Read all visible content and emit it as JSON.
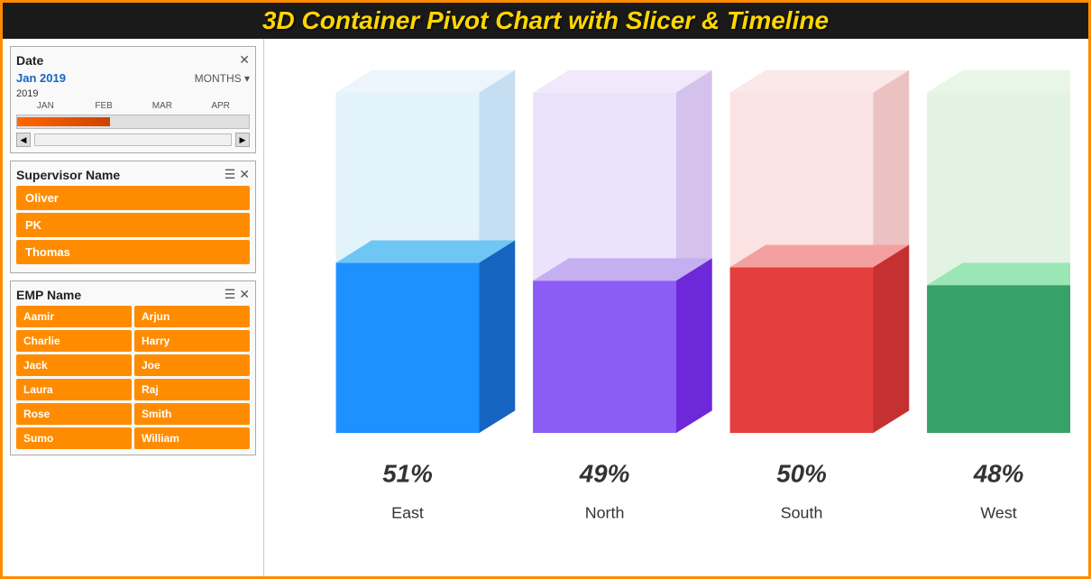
{
  "title": "3D Container Pivot Chart with Slicer & Timeline",
  "timeline": {
    "label": "Date",
    "selected": "Jan 2019",
    "period": "MONTHS",
    "year": "2019",
    "months": [
      "JAN",
      "FEB",
      "MAR",
      "APR"
    ]
  },
  "supervisor_slicer": {
    "label": "Supervisor Name",
    "items": [
      "Oliver",
      "PK",
      "Thomas"
    ]
  },
  "emp_slicer": {
    "label": "EMP Name",
    "items": [
      "Aamir",
      "Arjun",
      "Charlie",
      "Harry",
      "Jack",
      "Joe",
      "Laura",
      "Raj",
      "Rose",
      "Smith",
      "Sumo",
      "William"
    ]
  },
  "chart": {
    "bars": [
      {
        "label": "East",
        "percent": "51%",
        "color_front": "#1e90ff",
        "color_top": "#a8d8f0",
        "color_side": "#1565c0"
      },
      {
        "label": "North",
        "percent": "49%",
        "color_front": "#8b5cf6",
        "color_top": "#c4b5f0",
        "color_side": "#6d28d9"
      },
      {
        "label": "South",
        "percent": "50%",
        "color_front": "#e53e3e",
        "color_top": "#f5a0a0",
        "color_side": "#c53030"
      },
      {
        "label": "West",
        "percent": "48%",
        "color_front": "#38a169",
        "color_top": "#9ae6b4",
        "color_side": "#276749"
      }
    ]
  }
}
